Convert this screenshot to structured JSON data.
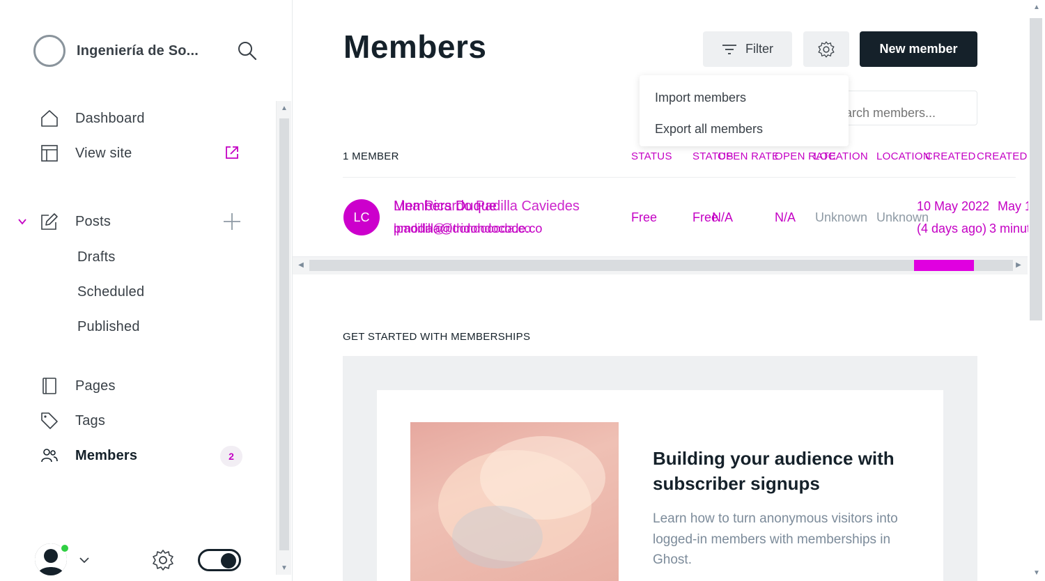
{
  "sidebar": {
    "site_name": "Ingeniería de So...",
    "nav": {
      "dashboard": "Dashboard",
      "view_site": "View site",
      "posts": "Posts",
      "drafts": "Drafts",
      "scheduled": "Scheduled",
      "published": "Published",
      "pages": "Pages",
      "tags": "Tags",
      "members": "Members"
    },
    "members_badge": "2"
  },
  "header": {
    "title": "Members",
    "filter_label": "Filter",
    "new_member_label": "New member"
  },
  "search": {
    "placeholder": "Search members..."
  },
  "settings_menu": {
    "items": [
      "Import members",
      "Export all members"
    ]
  },
  "table": {
    "count_label": "1 MEMBER",
    "columns": [
      "STATUS",
      "STATUS",
      "OPEN RATE",
      "OPEN RATE",
      "LOCATION",
      "LOCATION",
      "CREATED",
      "CREATED"
    ],
    "row": {
      "initials": "LC",
      "name_a": "Members Duque",
      "name_b": "Lina Ricardo Padilla Caviedes",
      "email_a": "pmodilla@tridondocode.co",
      "email_b": "lpadilla@ridondocoda.co",
      "status_a": "Free",
      "status_b": "Free",
      "open_rate_a": "N/A",
      "open_rate_b": "N/A",
      "location_a": "Unknown",
      "location_b": "Unknown",
      "created_date_a": "10 May 2022",
      "created_date_b": "May 1",
      "created_ago_a": "(4 days ago)",
      "created_ago_b": "3 minut"
    }
  },
  "get_started": {
    "title": "GET STARTED WITH MEMBERSHIPS",
    "heading": "Building your audience with subscriber signups",
    "text": "Learn how to turn anonymous visitors into logged-in members with memberships in Ghost."
  },
  "colors": {
    "accent": "#c400c4",
    "dark": "#15212a",
    "online": "#30cf43"
  }
}
